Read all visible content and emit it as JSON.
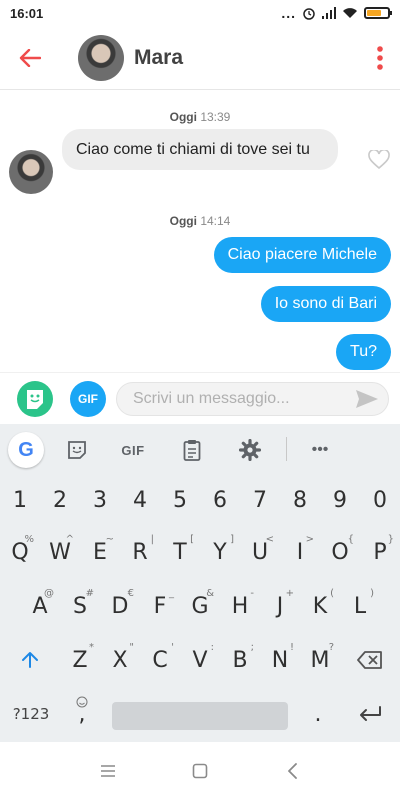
{
  "status_bar": {
    "time": "16:01",
    "dots": "..."
  },
  "header": {
    "contact_name": "Mara"
  },
  "chat": {
    "messages": [
      {
        "type": "timestamp",
        "day": "Oggi",
        "time": "13:39"
      },
      {
        "type": "incoming",
        "text": "Ciao come ti chiami di tove sei tu"
      },
      {
        "type": "timestamp",
        "day": "Oggi",
        "time": "14:14"
      },
      {
        "type": "outgoing",
        "text": "Ciao piacere Michele"
      },
      {
        "type": "outgoing",
        "text": "Io sono di Bari"
      },
      {
        "type": "outgoing",
        "text": "Tu?"
      }
    ]
  },
  "composer": {
    "gif_label": "GIF",
    "placeholder": "Scrivi un messaggio..."
  },
  "keyboard": {
    "toolbar": {
      "google": "G",
      "gif": "GIF",
      "more": "•••"
    },
    "number_row": [
      "1",
      "2",
      "3",
      "4",
      "5",
      "6",
      "7",
      "8",
      "9",
      "0"
    ],
    "row1": {
      "keys": [
        "Q",
        "W",
        "E",
        "R",
        "T",
        "Y",
        "U",
        "I",
        "O",
        "P"
      ],
      "hints": [
        "%",
        "^",
        "~",
        "|",
        "[",
        "]",
        "<",
        ">",
        "{",
        "}"
      ]
    },
    "row2": {
      "keys": [
        "A",
        "S",
        "D",
        "F",
        "G",
        "H",
        "J",
        "K",
        "L"
      ],
      "hints": [
        "@",
        "#",
        "€",
        "_",
        "&",
        "-",
        "+",
        "(",
        ")"
      ]
    },
    "row3": {
      "keys": [
        "Z",
        "X",
        "C",
        "V",
        "B",
        "N",
        "M"
      ],
      "hints": [
        "*",
        "\"",
        "'",
        ":",
        ";",
        "!",
        "?"
      ]
    },
    "bottom": {
      "symbols": "?123",
      "comma": ",",
      "period": "."
    }
  },
  "colors": {
    "accent_red": "#ef4b4b",
    "outgoing_bubble": "#1aa6f5",
    "sticker_green": "#2bc48a",
    "battery": "#f5a623"
  },
  "icons": {
    "back": "arrow-left-icon",
    "menu": "kebab-menu-icon",
    "heart": "heart-outline-icon",
    "send": "send-icon",
    "sticker": "sticker-icon",
    "emoji": "emoji-icon",
    "shift": "shift-arrow-icon",
    "backspace": "backspace-icon",
    "enter": "enter-icon",
    "settings": "gear-icon",
    "clipboard": "clipboard-icon"
  }
}
